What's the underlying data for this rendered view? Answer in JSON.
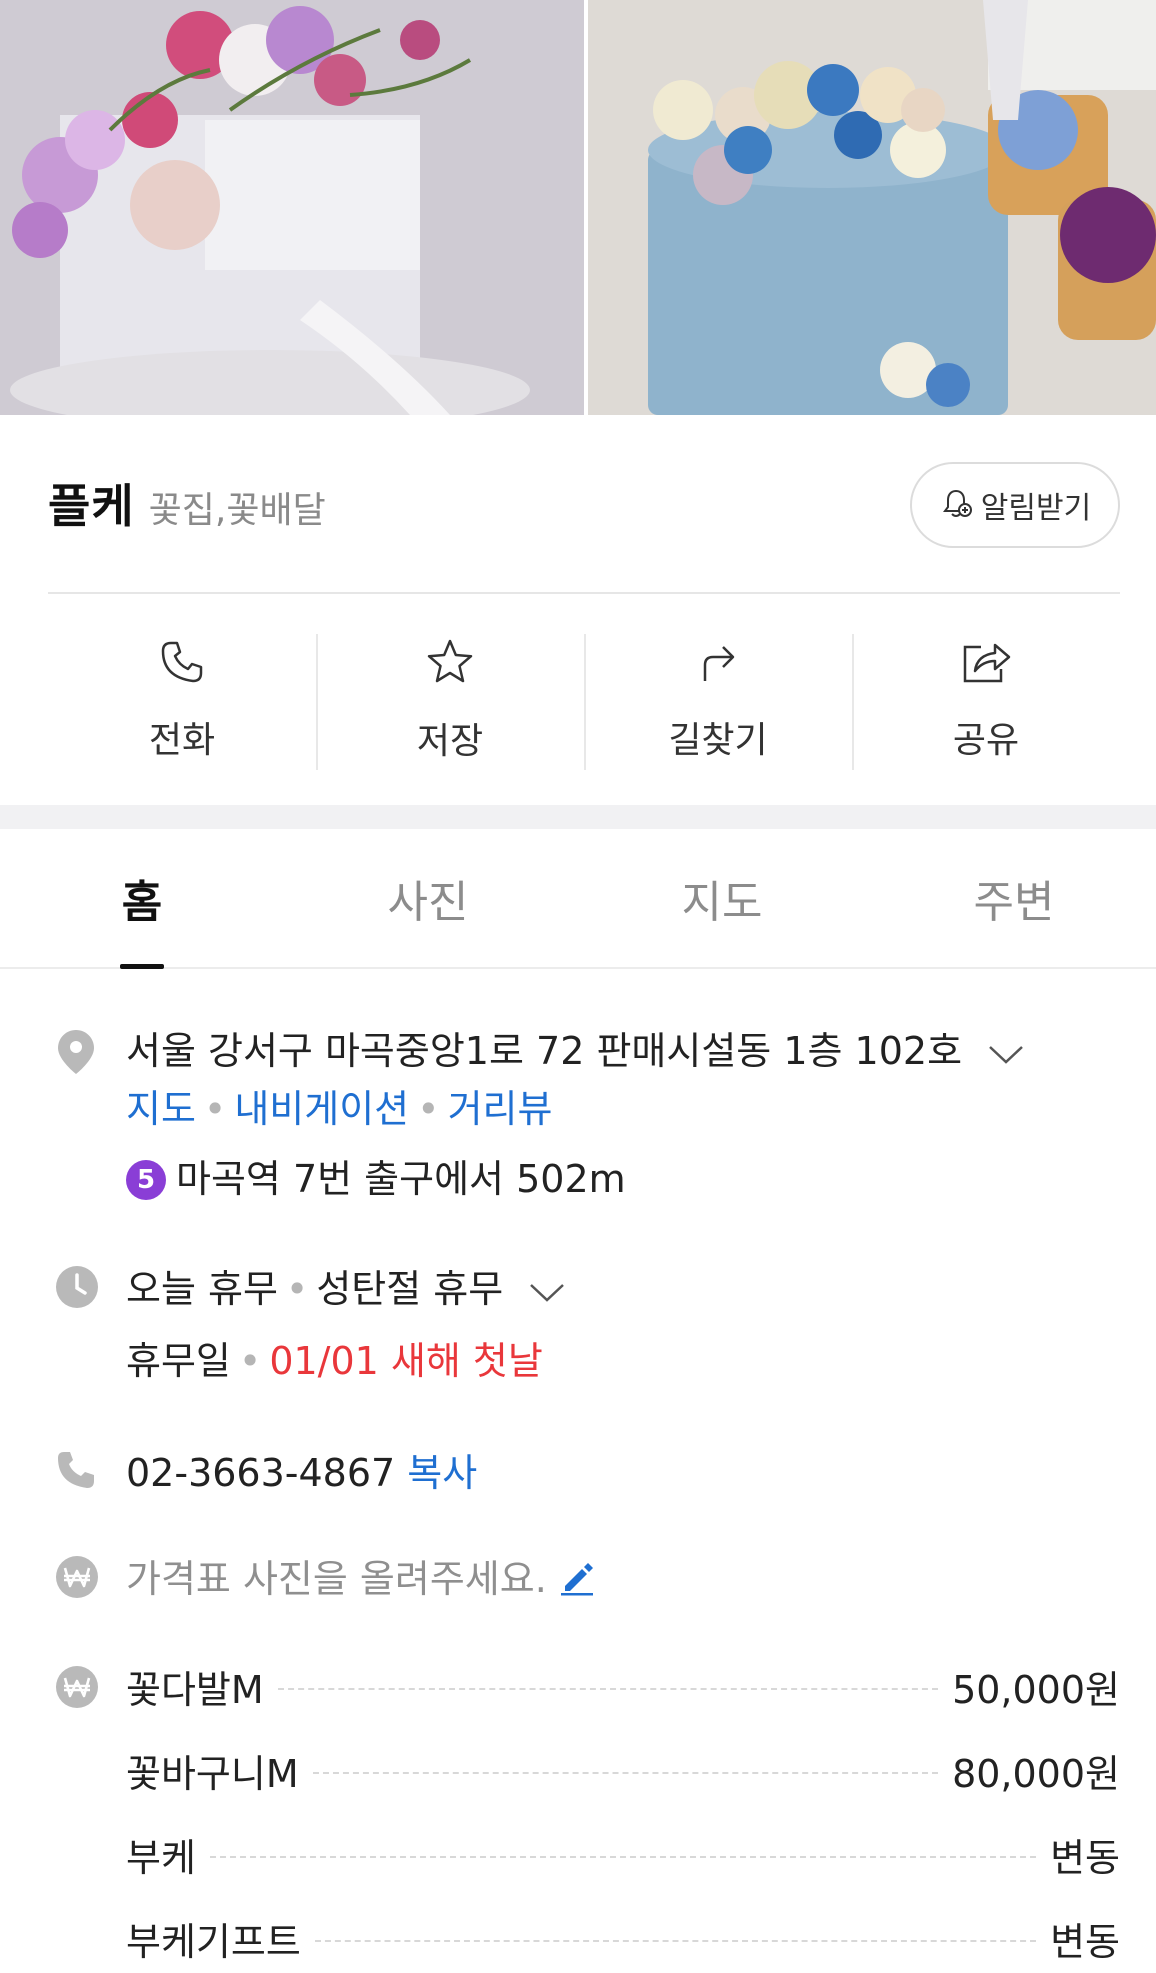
{
  "place": {
    "name": "플케",
    "category": "꽃집,꽃배달",
    "notify_label": "알림받기"
  },
  "actions": [
    {
      "label": "전화",
      "icon": "phone-icon"
    },
    {
      "label": "저장",
      "icon": "star-icon"
    },
    {
      "label": "길찾기",
      "icon": "directions-icon"
    },
    {
      "label": "공유",
      "icon": "share-icon"
    }
  ],
  "tabs": [
    {
      "label": "홈",
      "active": true
    },
    {
      "label": "사진",
      "active": false
    },
    {
      "label": "지도",
      "active": false
    },
    {
      "label": "주변",
      "active": false
    }
  ],
  "address": {
    "text": "서울 강서구 마곡중앙1로 72 판매시설동 1층 102호",
    "links": [
      "지도",
      "내비게이션",
      "거리뷰"
    ],
    "subway_line": "5",
    "subway_text": "마곡역 7번 출구에서 502m"
  },
  "hours": {
    "today": "오늘 휴무",
    "note": "성탄절 휴무",
    "holiday_label": "휴무일",
    "holiday_value": "01/01 새해 첫날"
  },
  "phone": {
    "number": "02-3663-4867",
    "copy_label": "복사"
  },
  "price_prompt": "가격표 사진을 올려주세요.",
  "menu": [
    {
      "name": "꽃다발M",
      "price": "50,000원"
    },
    {
      "name": "꽃바구니M",
      "price": "80,000원"
    },
    {
      "name": "부케",
      "price": "변동"
    },
    {
      "name": "부케기프트",
      "price": "변동"
    }
  ],
  "colors": {
    "link": "#1f6fd1",
    "holiday": "#e9373b",
    "subway_line_5": "#8a3ed6"
  }
}
